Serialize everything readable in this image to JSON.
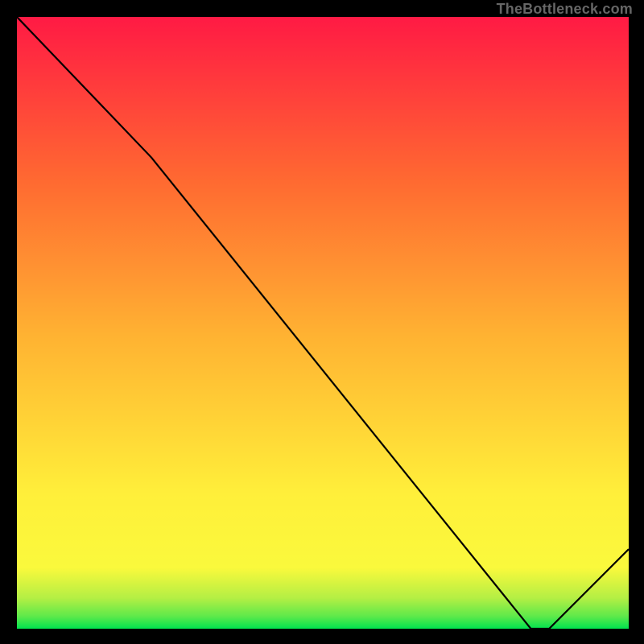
{
  "attribution": "TheBottleneck.com",
  "chart_data": {
    "type": "line",
    "title": "",
    "xlabel": "",
    "ylabel": "",
    "xlim": [
      0,
      100
    ],
    "ylim": [
      0,
      100
    ],
    "grid": false,
    "legend": false,
    "series": [
      {
        "name": "curve",
        "x": [
          0,
          22,
          84,
          87,
          100
        ],
        "y": [
          100,
          77,
          0,
          0,
          13
        ]
      }
    ],
    "gradient_stops": [
      {
        "pct": 0,
        "color": "#00e24f"
      },
      {
        "pct": 2,
        "color": "#5de94a"
      },
      {
        "pct": 5,
        "color": "#b4ef44"
      },
      {
        "pct": 10,
        "color": "#faf93c"
      },
      {
        "pct": 22,
        "color": "#ffef3a"
      },
      {
        "pct": 48,
        "color": "#ffb232"
      },
      {
        "pct": 73,
        "color": "#ff6a31"
      },
      {
        "pct": 100,
        "color": "#ff1a44"
      }
    ],
    "marker_label": {
      "text": "",
      "x": 85,
      "color": "#cc3333"
    }
  }
}
